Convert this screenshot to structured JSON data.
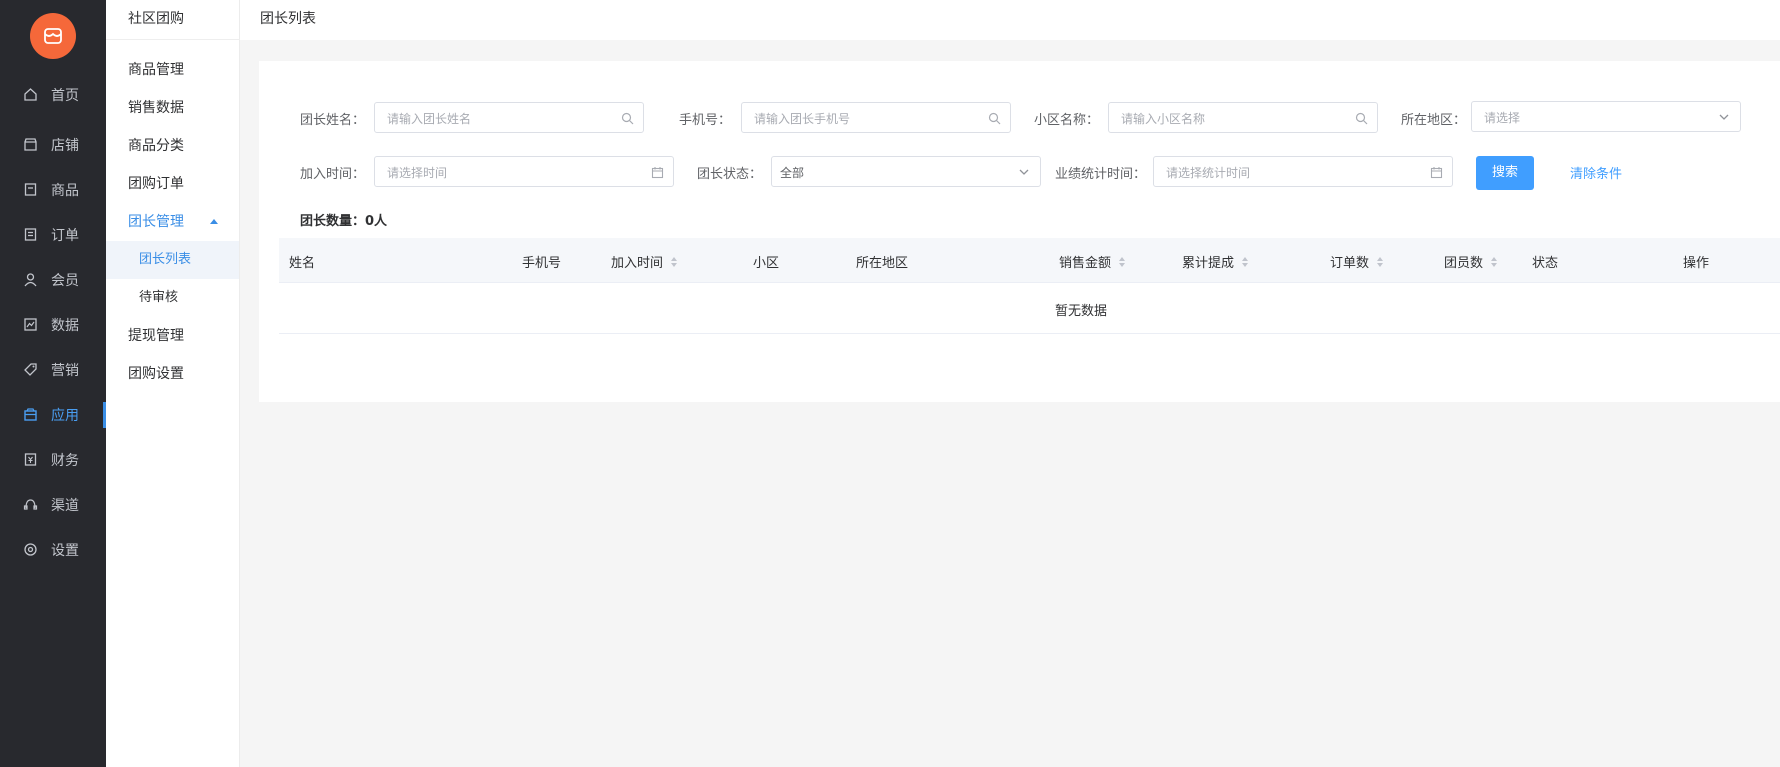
{
  "nav": {
    "items": [
      {
        "label": "首页",
        "icon": "home-icon"
      },
      {
        "label": "店铺",
        "icon": "store-icon"
      },
      {
        "label": "商品",
        "icon": "goods-icon"
      },
      {
        "label": "订单",
        "icon": "order-icon"
      },
      {
        "label": "会员",
        "icon": "member-icon"
      },
      {
        "label": "数据",
        "icon": "data-icon"
      },
      {
        "label": "营销",
        "icon": "tag-icon"
      },
      {
        "label": "应用",
        "icon": "app-icon"
      },
      {
        "label": "财务",
        "icon": "finance-icon"
      },
      {
        "label": "渠道",
        "icon": "channel-icon"
      },
      {
        "label": "设置",
        "icon": "gear-icon"
      }
    ],
    "active_index": 7,
    "accent": "#3a8ee6",
    "logo_color": "#f5683a"
  },
  "submenu": {
    "title": "社区团购",
    "items": [
      "商品管理",
      "销售数据",
      "商品分类",
      "团购订单",
      "团长管理",
      "提现管理",
      "团购设置"
    ],
    "open_group": "团长管理",
    "children": [
      "团长列表",
      "待审核"
    ],
    "active_child": "团长列表"
  },
  "header": {
    "title": "团长列表"
  },
  "filters": {
    "name": {
      "label": "团长姓名：",
      "placeholder": "请输入团长姓名"
    },
    "phone": {
      "label": "手机号：",
      "placeholder": "请输入团长手机号"
    },
    "community": {
      "label": "小区名称：",
      "placeholder": "请输入小区名称"
    },
    "region": {
      "label": "所在地区：",
      "placeholder": "请选择"
    },
    "join_time": {
      "label": "加入时间：",
      "placeholder": "请选择时间"
    },
    "status": {
      "label": "团长状态：",
      "value": "全部"
    },
    "stat_time": {
      "label": "业绩统计时间：",
      "placeholder": "请选择统计时间"
    },
    "search_button": "搜索",
    "clear_link": "清除条件"
  },
  "summary": {
    "label": "团长数量：",
    "count": "0人"
  },
  "table": {
    "columns": [
      "姓名",
      "手机号",
      "加入时间",
      "小区",
      "所在地区",
      "销售金额",
      "累计提成",
      "订单数",
      "团员数",
      "状态",
      "操作"
    ],
    "empty_text": "暂无数据"
  }
}
